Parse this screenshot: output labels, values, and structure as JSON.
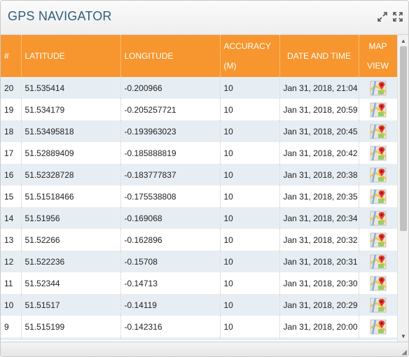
{
  "widget": {
    "title": "GPS NAVIGATOR",
    "icons": [
      "restore-icon",
      "expand-icon"
    ]
  },
  "table": {
    "headers": {
      "num": "#",
      "lat": "LATITUDE",
      "lon": "LONGITUDE",
      "acc1": "ACCURACY",
      "acc2": "(M)",
      "dt": "DATE AND TIME",
      "map1": "MAP",
      "map2": "VIEW"
    },
    "rows": [
      {
        "num": "20",
        "lat": "51.535414",
        "lon": "-0.200966",
        "acc": "10",
        "dt": "Jan 31, 2018, 21:04"
      },
      {
        "num": "19",
        "lat": "51.534179",
        "lon": "-0.205257721",
        "acc": "10",
        "dt": "Jan 31, 2018, 20:59"
      },
      {
        "num": "18",
        "lat": "51.53495818",
        "lon": "-0.193963023",
        "acc": "10",
        "dt": "Jan 31, 2018, 20:45"
      },
      {
        "num": "17",
        "lat": "51.52889409",
        "lon": "-0.185888819",
        "acc": "10",
        "dt": "Jan 31, 2018, 20:42"
      },
      {
        "num": "16",
        "lat": "51.52328728",
        "lon": "-0.183777837",
        "acc": "10",
        "dt": "Jan 31, 2018, 20:38"
      },
      {
        "num": "15",
        "lat": "51.51518466",
        "lon": "-0.175538808",
        "acc": "10",
        "dt": "Jan 31, 2018, 20:35"
      },
      {
        "num": "14",
        "lat": "51.51956",
        "lon": "-0.169068",
        "acc": "10",
        "dt": "Jan 31, 2018, 20:34"
      },
      {
        "num": "13",
        "lat": "51.52266",
        "lon": "-0.162896",
        "acc": "10",
        "dt": "Jan 31, 2018, 20:32"
      },
      {
        "num": "12",
        "lat": "51.522236",
        "lon": "-0.15708",
        "acc": "10",
        "dt": "Jan 31, 2018, 20:31"
      },
      {
        "num": "11",
        "lat": "51.52344",
        "lon": "-0.14713",
        "acc": "10",
        "dt": "Jan 31, 2018, 20:30"
      },
      {
        "num": "10",
        "lat": "51.51517",
        "lon": "-0.14119",
        "acc": "10",
        "dt": "Jan 31, 2018, 20:29"
      },
      {
        "num": "9",
        "lat": "51.515199",
        "lon": "-0.142316",
        "acc": "10",
        "dt": "Jan 31, 2018, 20:00"
      },
      {
        "num": "",
        "lat": "",
        "lon": "",
        "acc": "",
        "dt": ""
      }
    ],
    "map_icon": "map-pin-icon"
  },
  "colors": {
    "header_bg": "#f7962e",
    "title": "#2f5f7c",
    "row_alt": "#e7eef3"
  }
}
